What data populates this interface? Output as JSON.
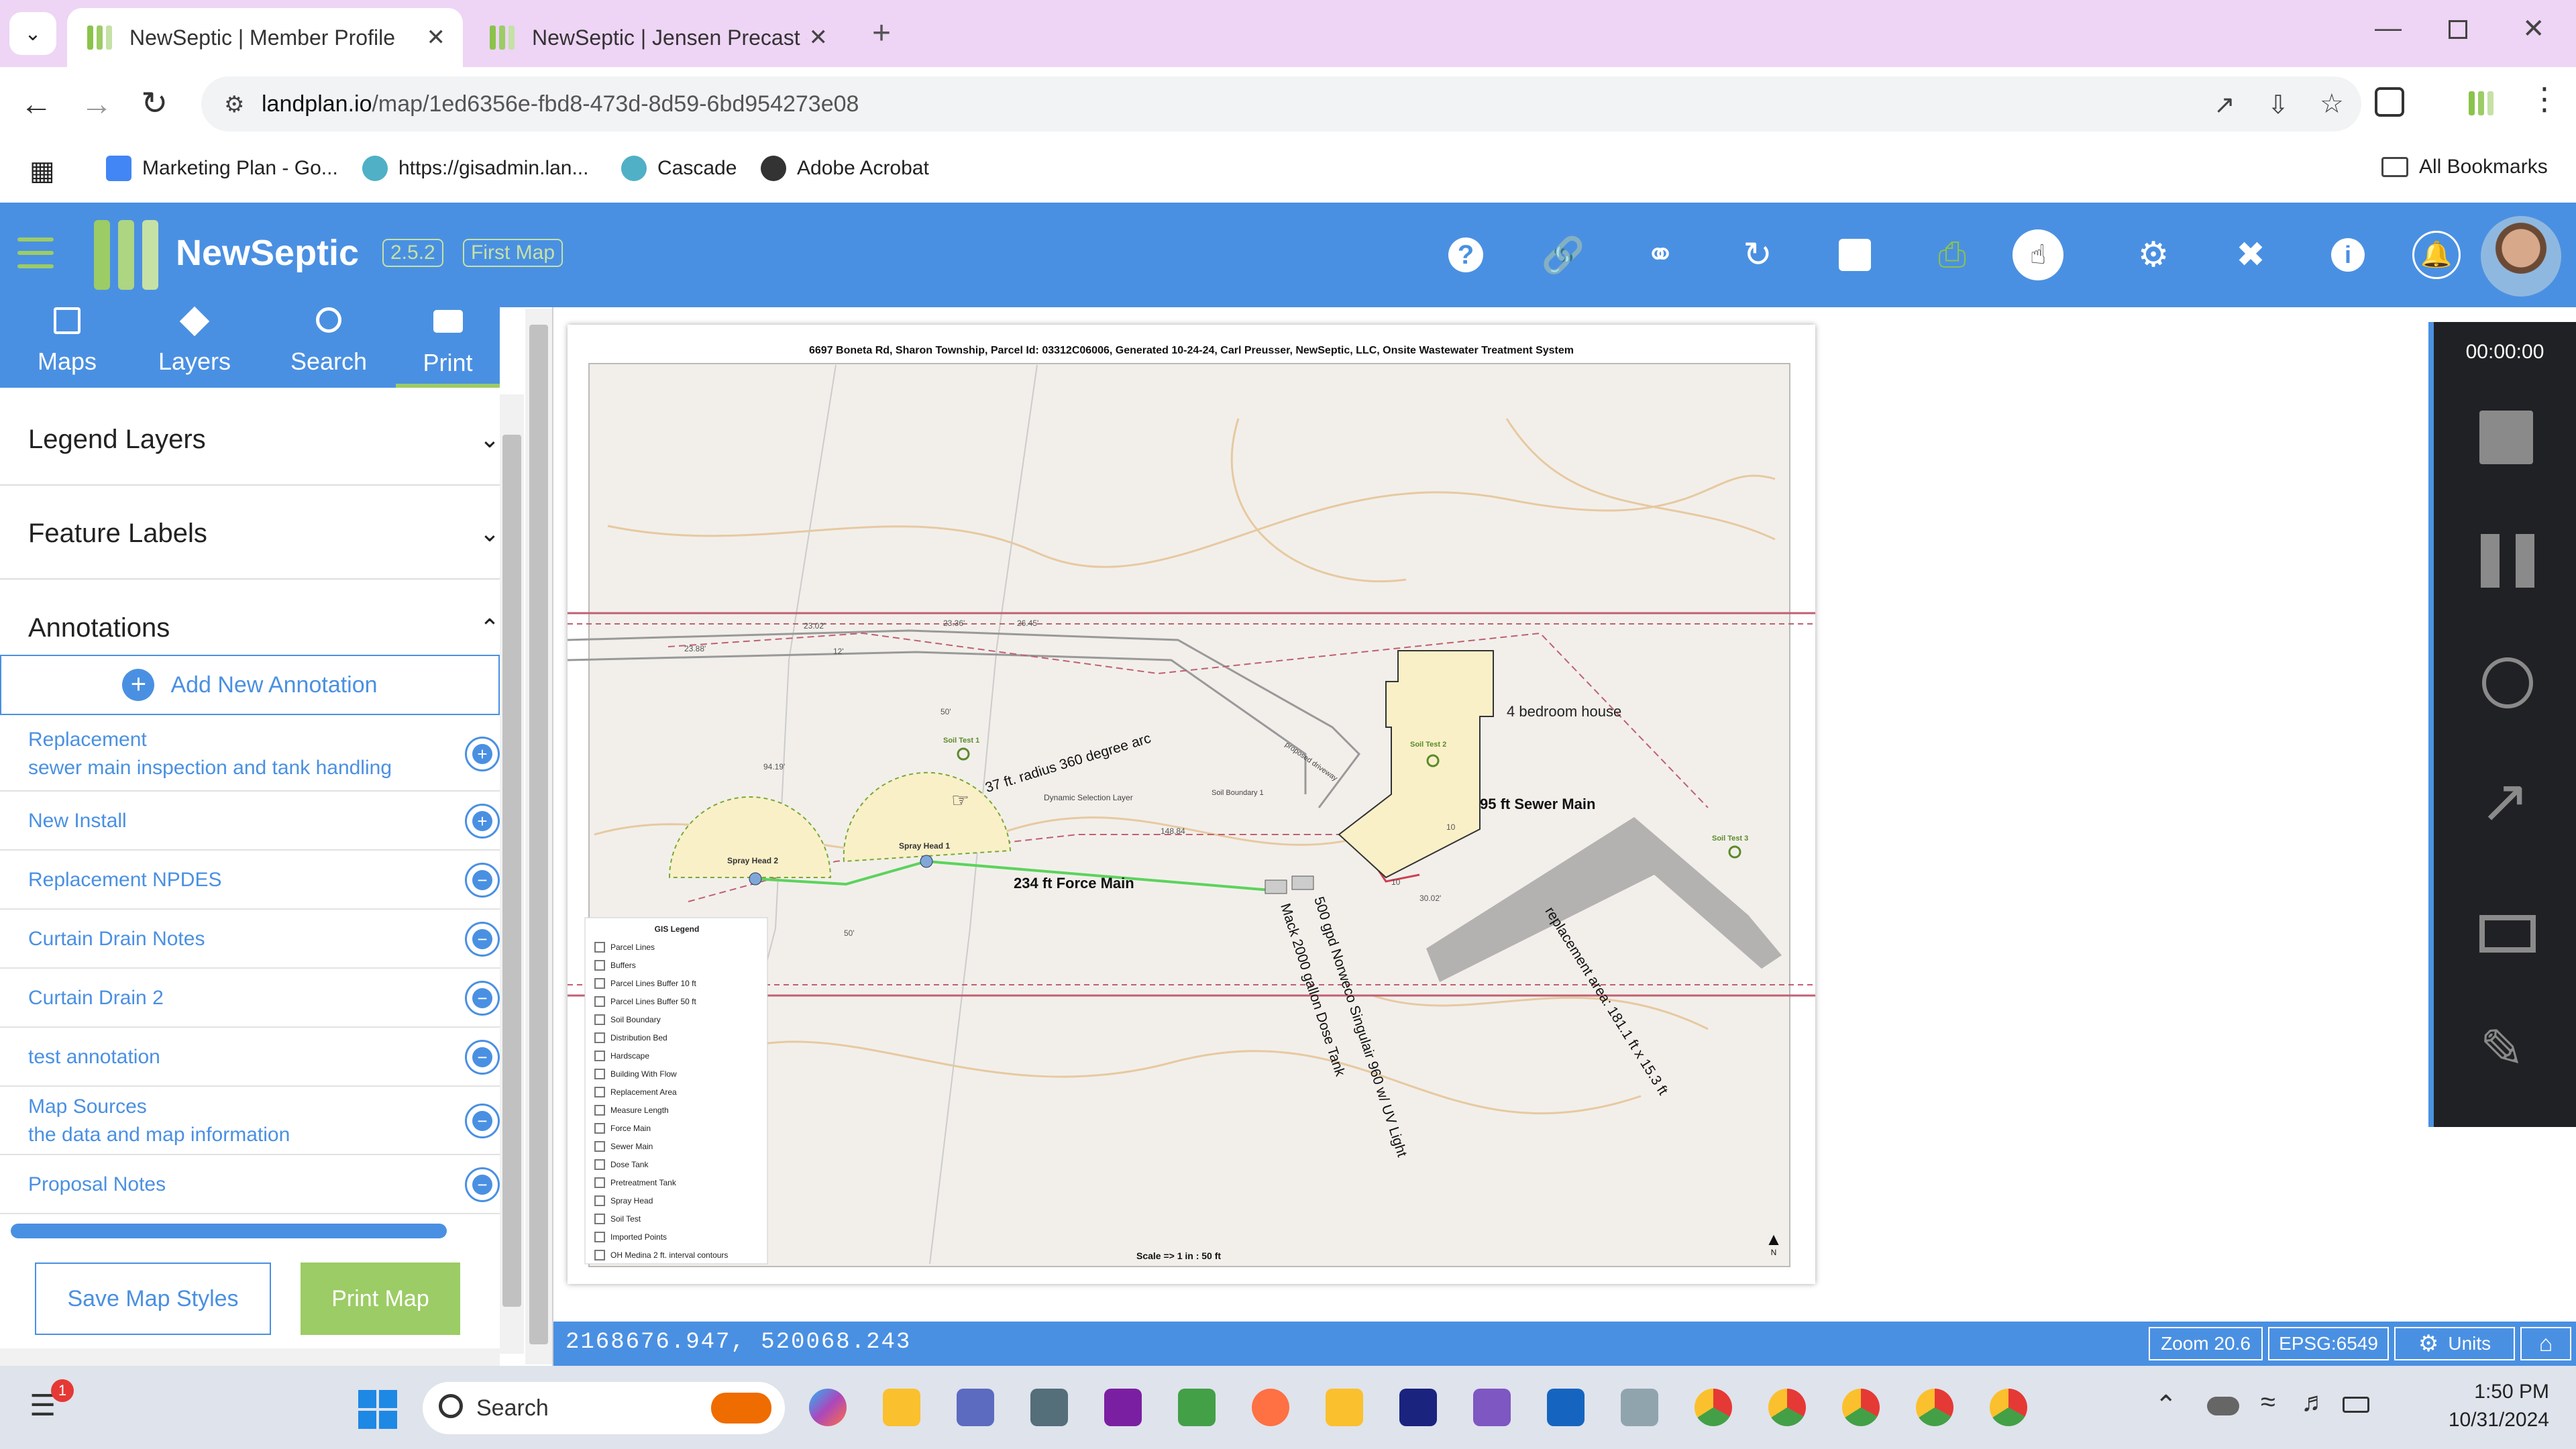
{
  "browser": {
    "tabs": [
      {
        "title": "NewSeptic | Member Profile",
        "active": true
      },
      {
        "title": "NewSeptic | Jensen Precast - La",
        "active": false
      }
    ],
    "url_host": "landplan.io",
    "url_path": "/map/1ed6356e-fbd8-473d-8d59-6bd954273e08",
    "bookmarks": [
      "Marketing Plan - Go...",
      "https://gisadmin.lan...",
      "Cascade",
      "Adobe Acrobat"
    ],
    "all_bookmarks": "All Bookmarks"
  },
  "app": {
    "name": "NewSeptic",
    "version": "2.5.2",
    "map_name": "First Map",
    "accent": "#4a90e2"
  },
  "nav_tabs": [
    {
      "label": "Maps",
      "icon": "map-icon"
    },
    {
      "label": "Layers",
      "icon": "layers-icon"
    },
    {
      "label": "Search",
      "icon": "search-icon"
    },
    {
      "label": "Print",
      "icon": "printer-icon"
    }
  ],
  "sections": {
    "legend_layers": "Legend Layers",
    "feature_labels": "Feature Labels",
    "annotations": "Annotations",
    "add_annotation": "Add New Annotation"
  },
  "annotations": [
    {
      "title": "Replacement",
      "subtitle": "sewer main inspection and tank handling"
    },
    {
      "title": "New Install",
      "subtitle": ""
    },
    {
      "title": "Replacement NPDES",
      "subtitle": ""
    },
    {
      "title": "Curtain Drain Notes",
      "subtitle": ""
    },
    {
      "title": "Curtain Drain 2",
      "subtitle": ""
    },
    {
      "title": "test annotation",
      "subtitle": ""
    },
    {
      "title": "Map Sources",
      "subtitle": "the data and map information"
    },
    {
      "title": "Proposal Notes",
      "subtitle": ""
    }
  ],
  "buttons": {
    "save_styles": "Save Map Styles",
    "print_map": "Print Map"
  },
  "map": {
    "title": "6697 Boneta Rd, Sharon Township,  Parcel Id: 03312C06006, Generated 10-24-24, Carl Preusser, NewSeptic, LLC, Onsite Wastewater Treatment System",
    "labels": {
      "house": "4 bedroom house",
      "sewer_main": "95 ft Sewer Main",
      "force_main": "234 ft Force Main",
      "radius": "37 ft. radius 360 degree arc",
      "dose_tank": "Mack 2000 gallon Dose Tank",
      "treatment": "500 gpd Norweco Singulair 960 w/ UV Light",
      "replacement": "replacement area: 181.1 ft x 15.3 ft",
      "spray1": "Spray Head 1",
      "spray2": "Spray Head 2",
      "soil1": "Soil Test 1",
      "soil2": "Soil Test 2",
      "soil3": "Soil Test 3",
      "dynamic": "Dynamic Selection Layer",
      "soilboundary": "Soil Boundary 1",
      "driveway": "proposed driveway",
      "scale": "Scale => 1 in : 50 ft",
      "north": "N",
      "dim_1": "23.02'",
      "dim_2": "23.36'",
      "dim_3": "26.45'",
      "dim_4": "23.88'",
      "dim_5": "12'",
      "dim_6": "94.19'",
      "dim_7": "50'",
      "dim_8": "50'",
      "dim_9": "148.84",
      "dim_10": "30.02'",
      "dim_11": "10",
      "dim_12": "10"
    },
    "legend_title": "GIS Legend",
    "legend": [
      "Parcel Lines",
      "Buffers",
      "Parcel Lines Buffer 10 ft",
      "Parcel Lines Buffer 50 ft",
      "Soil Boundary",
      "Distribution Bed",
      "Hardscape",
      "Building With Flow",
      "Replacement Area",
      "Measure Length",
      "Force Main",
      "Sewer Main",
      "Dose Tank",
      "Pretreatment Tank",
      "Spray Head",
      "Soil Test",
      "Imported Points",
      "OH Medina 2 ft. interval contours"
    ]
  },
  "status": {
    "coords": "2168676.947, 520068.243",
    "zoom": "Zoom 20.6",
    "epsg": "EPSG:6549",
    "units": "Units"
  },
  "recorder": {
    "time": "00:00:00"
  },
  "taskbar": {
    "search": "Search",
    "time": "1:50 PM",
    "date": "10/31/2024",
    "badge": "1"
  }
}
